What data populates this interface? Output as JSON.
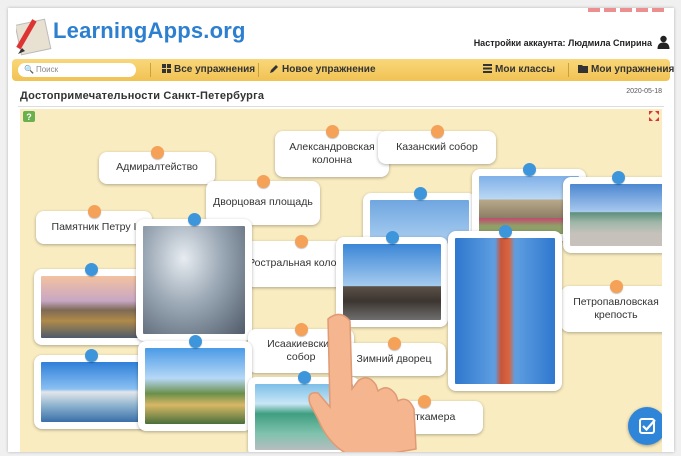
{
  "header": {
    "logo": "LearningApps.org",
    "account_label": "Настройки аккаунта: Людмила Спирина"
  },
  "navbar": {
    "search_placeholder": "Поиск",
    "all_exercises": "Все упражнения",
    "new_exercise": "Новое упражнение",
    "my_classes": "Мои классы",
    "my_exercises": "Мои упражнения"
  },
  "page": {
    "title": "Достопримечательности Санкт-Петербурга",
    "date": "2020-05-18"
  },
  "cards": {
    "admiralty": "Адмиралтейство",
    "alexander_column": "Александровская колонна",
    "kazan_cathedral": "Казанский собор",
    "palace_square": "Дворцовая площадь",
    "peter_monument": "Памятник Петру I",
    "rostral_column": "Ростральная колонна",
    "peter_paul_fortress": "Петропавловская крепость",
    "isaac_cathedral": "Исаакиевский собор",
    "winter_palace": "Зимний дворец",
    "kunstkamera": "Кунсткамера"
  },
  "colors": {
    "board_bg": "#f9ecc0",
    "nav_bg": "#f1c253",
    "pin_orange": "#f5a157",
    "pin_blue": "#3d96dc",
    "logo": "#2d7fcf",
    "check_button": "#2f86d8"
  },
  "icons": [
    "search-icon",
    "grid-icon",
    "pencil-icon",
    "list-icon",
    "folder-icon",
    "user-icon",
    "help-icon",
    "expand-icon",
    "check-icon",
    "hand-pointer-icon"
  ]
}
